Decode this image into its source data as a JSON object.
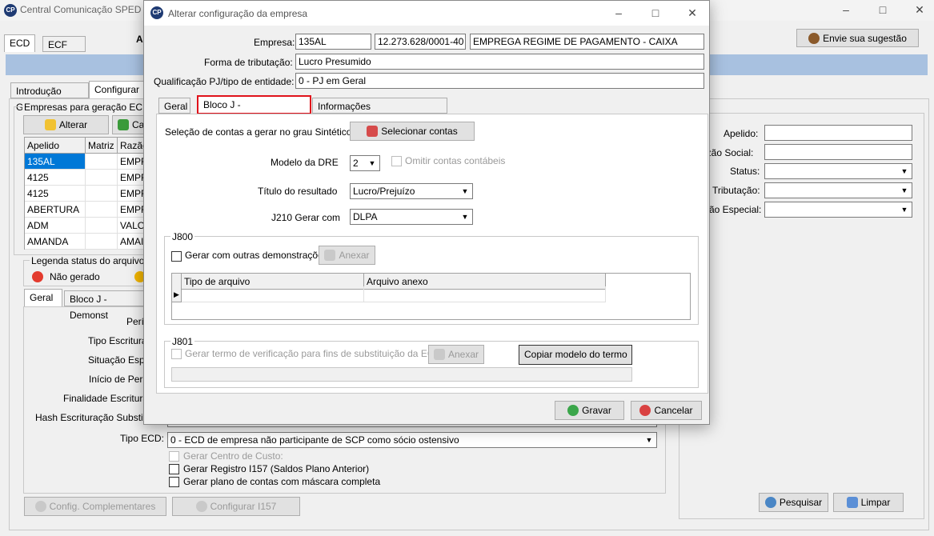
{
  "app": {
    "title": "Central Comunicação SPED",
    "main_tabs": [
      "ECD",
      "ECF"
    ],
    "suggestion_button": "Envie sua sugestão",
    "sub_tabs": [
      "Introdução Geral",
      "Configurar"
    ],
    "companies_group": "Empresas para geração ECD",
    "alter_button": "Alterar",
    "cancel_partial": "Ca",
    "grid_headers": [
      "Apelido",
      "Matriz",
      "Razão"
    ],
    "grid_rows": [
      {
        "apelido": "135AL",
        "razao": "EMPR"
      },
      {
        "apelido": "4125",
        "razao": "EMPR"
      },
      {
        "apelido": "4125",
        "razao": "EMPR"
      },
      {
        "apelido": "ABERTURA",
        "razao": "EMPR"
      },
      {
        "apelido": "ADM",
        "razao": "VALO"
      },
      {
        "apelido": "AMANDA",
        "razao": "AMAI"
      }
    ],
    "legend_title": "Legenda status do arquivo",
    "legend_items": [
      "Não gerado"
    ],
    "detail_tabs": [
      "Geral",
      "Bloco J - Demonst"
    ],
    "detail_labels": [
      "Perí",
      "Tipo Escritura",
      "Situação Espe",
      "Início de Perí",
      "Finalidade Escritura",
      "Hash Escrituração Substitu",
      "Tipo ECD:"
    ],
    "tipo_ecd_value": "0 - ECD de empresa não participante de SCP como sócio ostensivo",
    "checks": [
      "Gerar Centro de Custo:",
      "Gerar Registro I157 (Saldos Plano Anterior)",
      "Gerar plano de contas com máscara completa"
    ],
    "config_buttons": [
      "Config. Complementares",
      "Configurar I157"
    ],
    "filter_labels": [
      "Apelido:",
      "azão Social:",
      "Status:",
      "Tributação:",
      "ão Especial:"
    ],
    "search_button": "Pesquisar",
    "clear_button": "Limpar"
  },
  "dialog": {
    "title": "Alterar configuração da empresa",
    "empresa_label": "Empresa:",
    "empresa_code": "135AL",
    "empresa_cnpj": "12.273.628/0001-40",
    "empresa_name": "EMPREGA REGIME DE PAGAMENTO - CAIXA",
    "tributacao_label": "Forma de tributação:",
    "tributacao_value": "Lucro Presumido",
    "qualificacao_label": "Qualificação PJ/tipo de entidade:",
    "qualificacao_value": "0 - PJ em Geral",
    "tabs": [
      "Geral",
      "Bloco J - Demonstrações",
      "Informações Complementares"
    ],
    "selecao_label": "Seleção de contas a gerar no grau Sintético",
    "selecionar_button": "Selecionar contas",
    "dre_label": "Modelo da DRE",
    "dre_value": "2",
    "omitir_label": "Omitir contas contábeis",
    "titulo_label": "Título do resultado",
    "titulo_value": "Lucro/Prejuízo",
    "j210_label": "J210 Gerar com",
    "j210_value": "DLPA",
    "j800_title": "J800",
    "j800_check": "Gerar com outras demonstrações",
    "anexar_button": "Anexar",
    "j800_headers": [
      "Tipo de arquivo",
      "Arquivo anexo"
    ],
    "j801_title": "J801",
    "j801_check": "Gerar termo de verificação para fins de substituição da ECD",
    "copiar_button": "Copiar modelo do termo",
    "gravar_button": "Gravar",
    "cancelar_button": "Cancelar",
    "highlight_color": "#e0121b"
  }
}
